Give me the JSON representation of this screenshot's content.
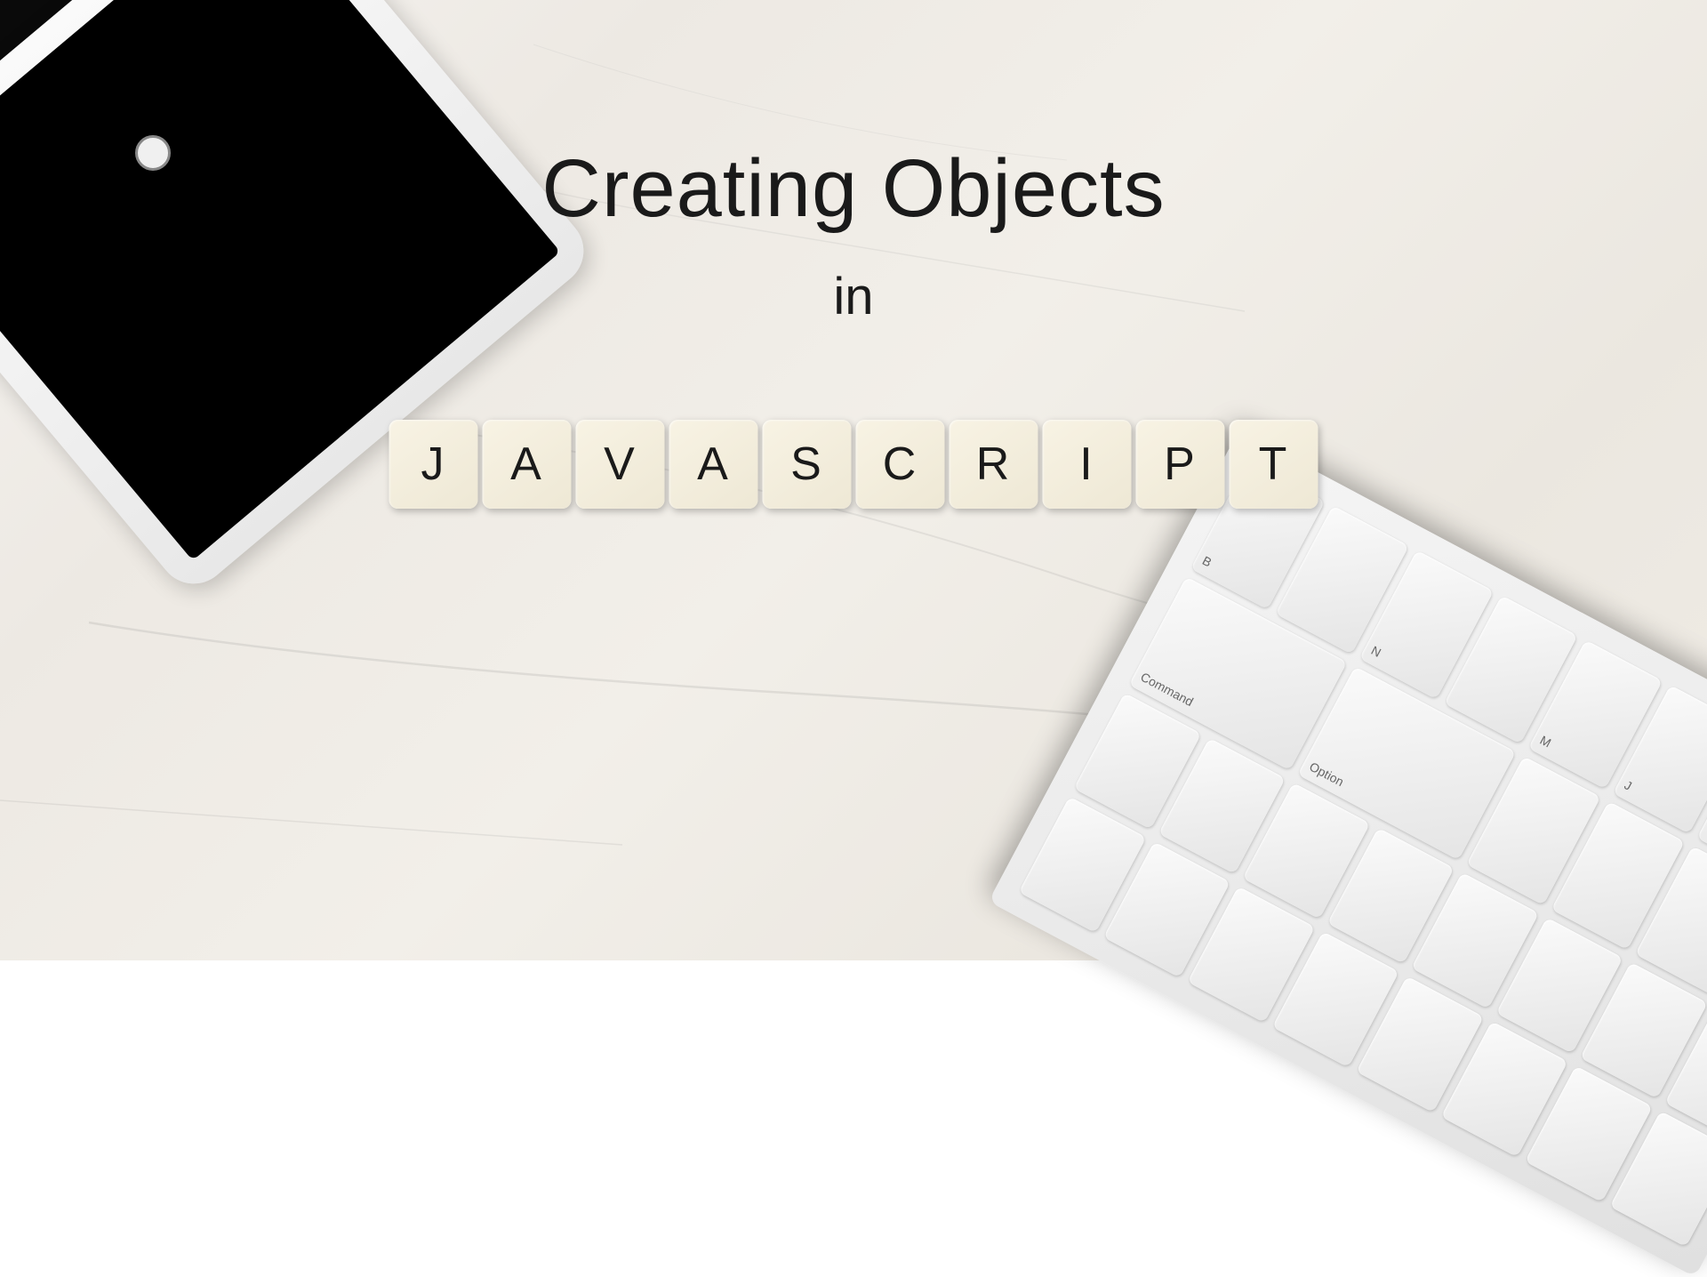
{
  "title": {
    "line1": "Creating Objects",
    "line2": "in"
  },
  "tiles": [
    "J",
    "A",
    "V",
    "A",
    "S",
    "C",
    "R",
    "I",
    "P",
    "T"
  ],
  "keyboard_keys": [
    "B",
    "",
    "N",
    "",
    "M",
    "J",
    "",
    "Command",
    "Option",
    "",
    "",
    "",
    "",
    "",
    "",
    ""
  ]
}
